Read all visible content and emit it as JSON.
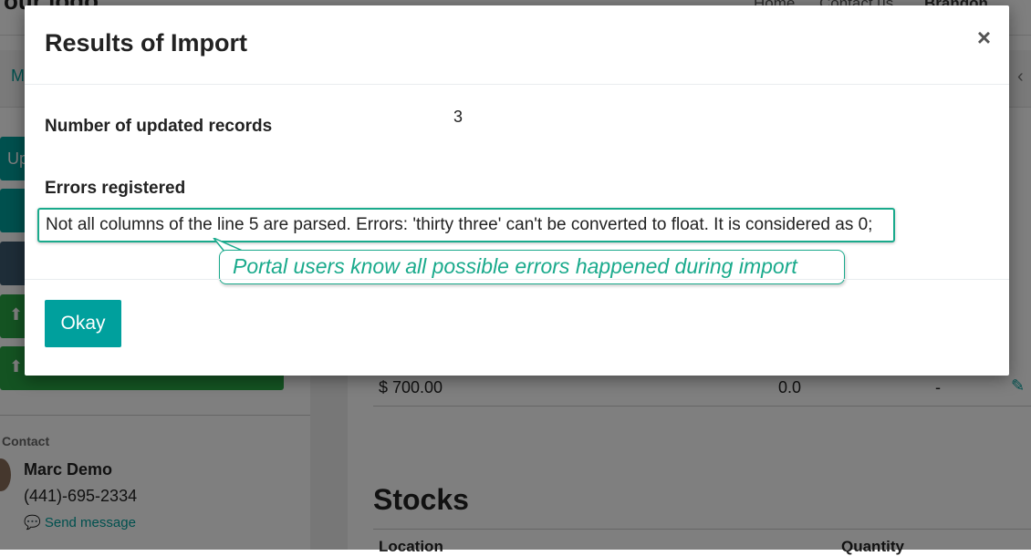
{
  "background": {
    "logo": "our logo",
    "nav": [
      "Home",
      "Contact us",
      "Brandon Freeman"
    ],
    "sub_bar_label": "M",
    "side_button_label": "Up",
    "price": "$ 700.00",
    "qty": "0.0",
    "dash": "-",
    "contact_heading": "Contact",
    "contact_name": "Marc Demo",
    "contact_phone": "(441)-695-2334",
    "send_message": "Send message",
    "stocks_heading": "Stocks",
    "stocks_col_location": "Location",
    "stocks_col_quantity": "Quantity"
  },
  "modal": {
    "title": "Results of Import",
    "close": "×",
    "updated_label": "Number of updated records",
    "updated_value": "3",
    "errors_label": "Errors registered",
    "error_message": "Not all columns of the line 5 are parsed. Errors: 'thirty three' can't be converted to float. It is considered as 0;",
    "callout": "Portal users know all possible errors happened during import",
    "okay_label": "Okay"
  },
  "colors": {
    "accent": "#00a09d",
    "callout": "#1aaa8c",
    "overlay": "rgba(0,0,0,0.5)"
  }
}
